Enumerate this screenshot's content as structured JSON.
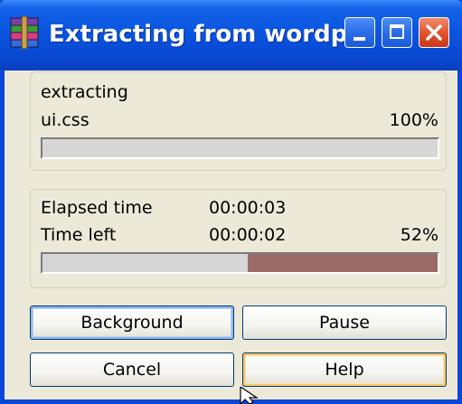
{
  "window": {
    "title": "Extracting from wordp...",
    "app_icon": "winrar-books-icon"
  },
  "title_buttons": {
    "minimize": "minimize-icon",
    "maximize": "maximize-icon",
    "close": "close-icon"
  },
  "file_group": {
    "status": "extracting",
    "filename": "ui.css",
    "percent": "100%",
    "progress": 1.0
  },
  "time_group": {
    "elapsed_label": "Elapsed time",
    "elapsed_value": "00:00:03",
    "left_label": "Time left",
    "left_value": "00:00:02",
    "percent": "52%",
    "progress": 0.52
  },
  "buttons": {
    "background": "Background",
    "pause": "Pause",
    "cancel": "Cancel",
    "help": "Help"
  },
  "colors": {
    "titlebar": "#0a55e0",
    "client": "#ece9d8",
    "progress_fill": "#9a6b68",
    "close_button": "#e0502a"
  }
}
